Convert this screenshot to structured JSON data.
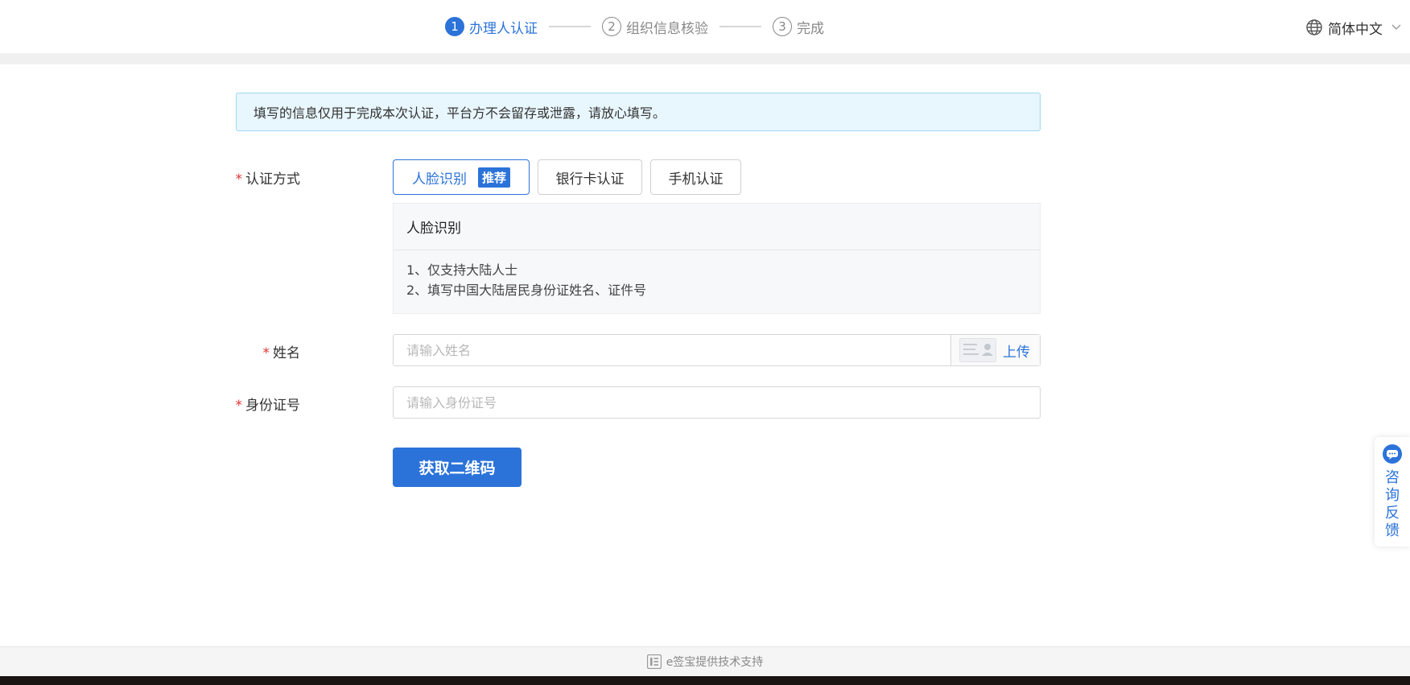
{
  "steps": [
    {
      "num": "1",
      "label": "办理人认证",
      "state": "active"
    },
    {
      "num": "2",
      "label": "组织信息核验",
      "state": "inactive"
    },
    {
      "num": "3",
      "label": "完成",
      "state": "inactive"
    }
  ],
  "language": {
    "label": "简体中文",
    "icon": "globe-icon"
  },
  "notice": "填写的信息仅用于完成本次认证，平台方不会留存或泄露，请放心填写。",
  "form": {
    "required_mark": "*",
    "method_label": "认证方式",
    "methods": [
      {
        "label": "人脸识别",
        "badge": "推荐",
        "selected": true
      },
      {
        "label": "银行卡认证",
        "selected": false
      },
      {
        "label": "手机认证",
        "selected": false
      }
    ],
    "info": {
      "title": "人脸识别",
      "lines": [
        "1、仅支持大陆人士",
        "2、填写中国大陆居民身份证姓名、证件号"
      ]
    },
    "name_label": "姓名",
    "name_placeholder": "请输入姓名",
    "name_value": "",
    "upload_label": "上传",
    "id_label": "身份证号",
    "id_placeholder": "请输入身份证号",
    "id_value": "",
    "submit_label": "获取二维码"
  },
  "consult": {
    "label": "咨询反馈",
    "icon": "chat-bubble-icon"
  },
  "footer": {
    "text": "e签宝提供技术支持",
    "icon": "esign-logo-icon"
  },
  "colors": {
    "accent": "#2b73d9",
    "required": "#e03232",
    "notice_bg": "#e8f6fd",
    "notice_border": "#9ed8f4"
  }
}
